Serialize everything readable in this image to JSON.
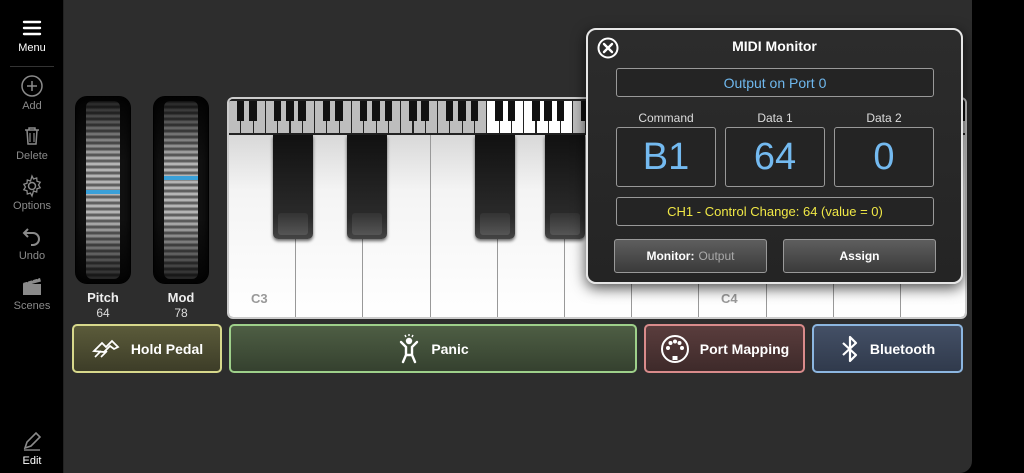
{
  "sidebar": {
    "items": [
      {
        "label": "Menu",
        "icon": "menu-icon"
      },
      {
        "label": "Add",
        "icon": "plus-circle-icon"
      },
      {
        "label": "Delete",
        "icon": "trash-icon"
      },
      {
        "label": "Options",
        "icon": "gear-icon"
      },
      {
        "label": "Undo",
        "icon": "undo-icon"
      },
      {
        "label": "Scenes",
        "icon": "clapperboard-icon"
      },
      {
        "label": "Edit",
        "icon": "pencil-icon"
      }
    ]
  },
  "wheels": {
    "pitch": {
      "label": "Pitch",
      "value": "64",
      "level": 0.5
    },
    "mod": {
      "label": "Mod",
      "value": "78",
      "level": 0.61
    }
  },
  "keyboard": {
    "labels": [
      "C3",
      "C4"
    ]
  },
  "buttons": {
    "hold_pedal": "Hold Pedal",
    "panic": "Panic",
    "port_mapping": "Port Mapping",
    "bluetooth": "Bluetooth"
  },
  "monitor": {
    "title": "MIDI Monitor",
    "port": "Output on Port 0",
    "headers": {
      "command": "Command",
      "data1": "Data 1",
      "data2": "Data 2"
    },
    "values": {
      "command": "B1",
      "data1": "64",
      "data2": "0"
    },
    "description": "CH1 - Control Change: 64 (value = 0)",
    "monitor_label": "Monitor:",
    "monitor_value": "Output",
    "assign": "Assign"
  },
  "colors": {
    "accent_blue": "#74baf0",
    "desc_yellow": "#f0e846",
    "hold_border": "#d7d88b",
    "panic_border": "#9ed08a",
    "portmap_border": "#d98b8b",
    "bt_border": "#8cb6e0"
  }
}
